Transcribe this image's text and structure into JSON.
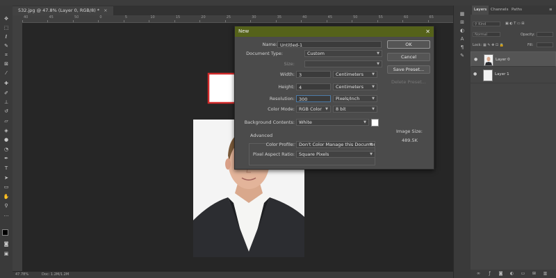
{
  "document": {
    "tab_title": "532.jpg @ 47.8% (Layer 0, RGB/8) *",
    "status_zoom": "47.78%",
    "status_doc": "Doc: 1.2M/1.2M"
  },
  "ruler": {
    "top_ticks": [
      "40",
      "45",
      "50",
      "0",
      "5",
      "10",
      "15",
      "20",
      "25",
      "30",
      "35",
      "40",
      "45",
      "50",
      "55",
      "60",
      "65"
    ]
  },
  "dialog": {
    "title": "New",
    "name_label": "Name:",
    "name_value": "Untitled-1",
    "doctype_label": "Document Type:",
    "doctype_value": "Custom",
    "size_label": "Size:",
    "size_value": "",
    "width_label": "Width:",
    "width_value": "3",
    "width_unit": "Centimeters",
    "height_label": "Height:",
    "height_value": "4",
    "height_unit": "Centimeters",
    "resolution_label": "Resolution:",
    "resolution_value": "300",
    "resolution_unit": "Pixels/Inch",
    "colormode_label": "Color Mode:",
    "colormode_value": "RGB Color",
    "bitdepth_value": "8 bit",
    "bg_label": "Background Contents:",
    "bg_value": "White",
    "advanced_label": "Advanced",
    "color_profile_label": "Color Profile:",
    "color_profile_value": "Don't Color Manage this Document",
    "pixel_aspect_label": "Pixel Aspect Ratio:",
    "pixel_aspect_value": "Square Pixels",
    "ok_label": "OK",
    "cancel_label": "Cancel",
    "save_preset_label": "Save Preset...",
    "delete_preset_label": "Delete Preset...",
    "image_size_label": "Image Size:",
    "image_size_value": "489.5K"
  },
  "layers_panel": {
    "tabs": [
      "Layers",
      "Channels",
      "Paths"
    ],
    "kind_label": "Kind",
    "blend_mode": "Normal",
    "opacity_label": "Opacity:",
    "lock_label": "Lock:",
    "fill_label": "Fill:",
    "layers": [
      {
        "name": "Layer 0",
        "selected": true
      },
      {
        "name": "Layer 1",
        "selected": false
      }
    ]
  },
  "colors": {
    "dialog_title_bar": "#55621a",
    "arrow_outline": "#d12a2a",
    "workspace": "#282828"
  }
}
